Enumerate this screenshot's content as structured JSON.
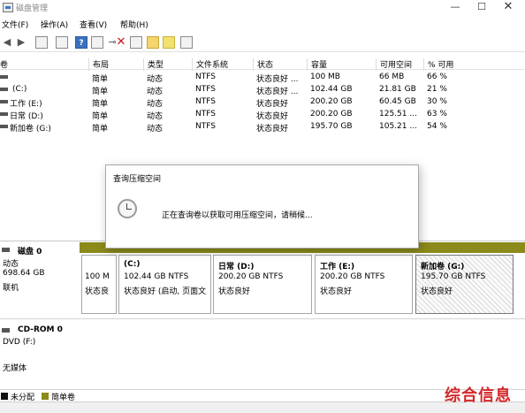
{
  "window": {
    "title": "磁盘管理",
    "minimize_glyph": "—",
    "maximize_glyph": "☐",
    "close_glyph": "✕"
  },
  "menu": [
    "文件(F)",
    "操作(A)",
    "查看(V)",
    "帮助(H)"
  ],
  "toolbar": {
    "icons": [
      "back-arrow-icon",
      "forward-arrow-icon",
      "console-tree-icon",
      "list-view-icon",
      "help-icon",
      "properties-icon",
      "connect-icon",
      "delete-icon",
      "checklist-icon",
      "folder-icon",
      "folder-search-icon",
      "detail-view-icon"
    ]
  },
  "volumes": {
    "columns": [
      "卷",
      "布局",
      "类型",
      "文件系统",
      "状态",
      "容量",
      "可用空间",
      "% 可用"
    ],
    "rows": [
      {
        "name": "",
        "layout": "简单",
        "type": "动态",
        "fs": "NTFS",
        "status": "状态良好 ...",
        "capacity": "100 MB",
        "free": "66 MB",
        "pct": "66 %"
      },
      {
        "name": "(C:)",
        "layout": "简单",
        "type": "动态",
        "fs": "NTFS",
        "status": "状态良好 ...",
        "capacity": "102.44 GB",
        "free": "21.81 GB",
        "pct": "21 %"
      },
      {
        "name": "工作 (E:)",
        "layout": "简单",
        "type": "动态",
        "fs": "NTFS",
        "status": "状态良好",
        "capacity": "200.20 GB",
        "free": "60.45 GB",
        "pct": "30 %"
      },
      {
        "name": "日常 (D:)",
        "layout": "简单",
        "type": "动态",
        "fs": "NTFS",
        "status": "状态良好",
        "capacity": "200.20 GB",
        "free": "125.51 ...",
        "pct": "63 %"
      },
      {
        "name": "新加卷 (G:)",
        "layout": "简单",
        "type": "动态",
        "fs": "NTFS",
        "status": "状态良好",
        "capacity": "195.70 GB",
        "free": "105.21 ...",
        "pct": "54 %"
      }
    ]
  },
  "dialog": {
    "title": "查询压缩空间",
    "message": "正在查询卷以获取可用压缩空间，请稍候..."
  },
  "disk0": {
    "name": "磁盘 0",
    "type": "动态",
    "size": "698.64 GB",
    "state": "联机",
    "partitions": [
      {
        "line1": "",
        "line2": "100 M",
        "line3": "状态良"
      },
      {
        "line1": "(C:)",
        "line2": "102.44 GB NTFS",
        "line3": "状态良好 (启动, 页面文"
      },
      {
        "line1": "日常  (D:)",
        "line2": "200.20 GB NTFS",
        "line3": "状态良好"
      },
      {
        "line1": "工作  (E:)",
        "line2": "200.20 GB NTFS",
        "line3": "状态良好"
      },
      {
        "line1": "新加卷  (G:)",
        "line2": "195.70 GB NTFS",
        "line3": "状态良好"
      }
    ]
  },
  "cdrom": {
    "name": "CD-ROM 0",
    "drive": "DVD (F:)",
    "media": "无媒体"
  },
  "legend": [
    {
      "label": "未分配",
      "color": "#111111"
    },
    {
      "label": "简单卷",
      "color": "#8b8a1a"
    }
  ],
  "watermark": "综合信息"
}
